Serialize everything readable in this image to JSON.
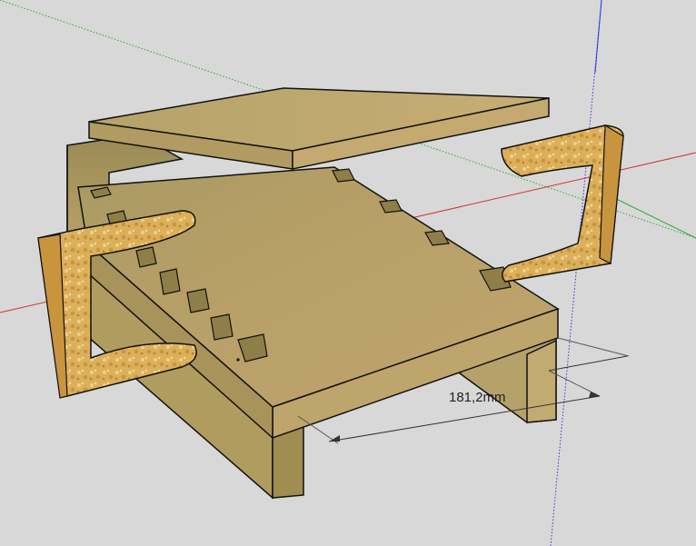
{
  "app": "SketchUp",
  "viewport": {
    "background": "#d8d8d8",
    "axes": {
      "red": "#d23232",
      "green": "#2fa82f",
      "blue": "#3232e0"
    }
  },
  "model": {
    "description_parts": [
      "lid-panel",
      "box-body",
      "left-handle",
      "right-handle",
      "legs"
    ],
    "wood_color": "#b79a5e",
    "handle_color": "#d9ab55",
    "edge_color": "#111111"
  },
  "dimension": {
    "label": "181,2mm"
  }
}
